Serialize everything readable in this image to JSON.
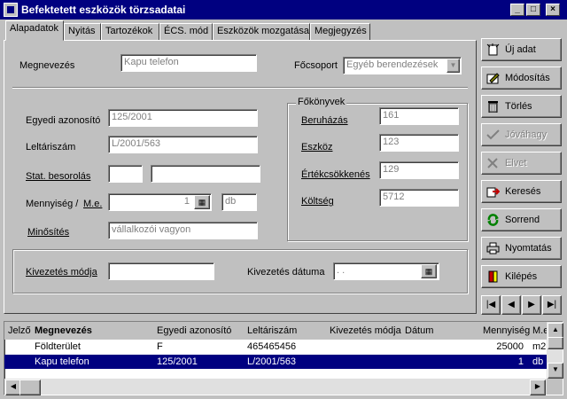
{
  "window": {
    "title": "Befektetett eszközök törzsadatai"
  },
  "tabs": [
    "Alapadatok",
    "Nyitás",
    "Tartozékok",
    "ÉCS. mód",
    "Eszközök mozgatása",
    "Megjegyzés"
  ],
  "form": {
    "megnevezes_label": "Megnevezés",
    "megnevezes_value": "Kapu telefon",
    "focsoport_label": "Főcsoport",
    "focsoport_value": "Egyéb berendezések",
    "egyedi_label": "Egyedi azonosító",
    "egyedi_value": "125/2001",
    "leltar_label": "Leltáriszám",
    "leltar_value": "L/2001/563",
    "stat_label": "Stat. besorolás",
    "stat_value1": "",
    "stat_value2": "",
    "mennyiseg_label": "Mennyiség /",
    "me_label": "M.e.",
    "mennyiseg_value": "1",
    "me_value": "db",
    "minosites_label": "Minősítés",
    "minosites_value": "vállalkozói vagyon",
    "kivmod_label": "Kivezetés módja",
    "kivmod_value": "",
    "kivdat_label": "Kivezetés dátuma",
    "kivdat_value": ". ."
  },
  "fokonyv": {
    "title": "Főkönyvek",
    "beruhazas_label": "Beruházás",
    "beruhazas_value": "161",
    "eszkoz_label": "Eszköz",
    "eszkoz_value": "123",
    "ertekcs_label": "Értékcsökkenés",
    "ertekcs_value": "129",
    "koltseg_label": "Költség",
    "koltseg_value": "5712"
  },
  "buttons": {
    "uj": "Új adat",
    "modositas": "Módosítás",
    "torles": "Törlés",
    "jovahagy": "Jóváhagy",
    "elvet": "Elvet",
    "kereses": "Keresés",
    "sorrend": "Sorrend",
    "nyomtatas": "Nyomtatás",
    "kilepes": "Kilépés"
  },
  "nav": {
    "first": "|◀",
    "prev": "◀",
    "next": "▶",
    "last": "▶|"
  },
  "grid": {
    "headers": [
      "Jelző",
      "Megnevezés",
      "Egyedi azonosító",
      "Leltáriszám",
      "Kivezetés módja",
      "Dátum",
      "Mennyiség",
      "M.e"
    ],
    "rows": [
      {
        "jelzo": "",
        "megnevezes": "Földterület",
        "egyedi": "F",
        "leltar": "465465456",
        "kivmod": "",
        "datum": "",
        "mennyiseg": "25000",
        "me": "m2"
      },
      {
        "jelzo": "",
        "megnevezes": "Kapu telefon",
        "egyedi": "125/2001",
        "leltar": "L/2001/563",
        "kivmod": "",
        "datum": "",
        "mennyiseg": "1",
        "me": "db"
      }
    ]
  },
  "colors": {
    "titlebar": "#000080",
    "selection": "#000080",
    "face": "#c0c0c0"
  }
}
